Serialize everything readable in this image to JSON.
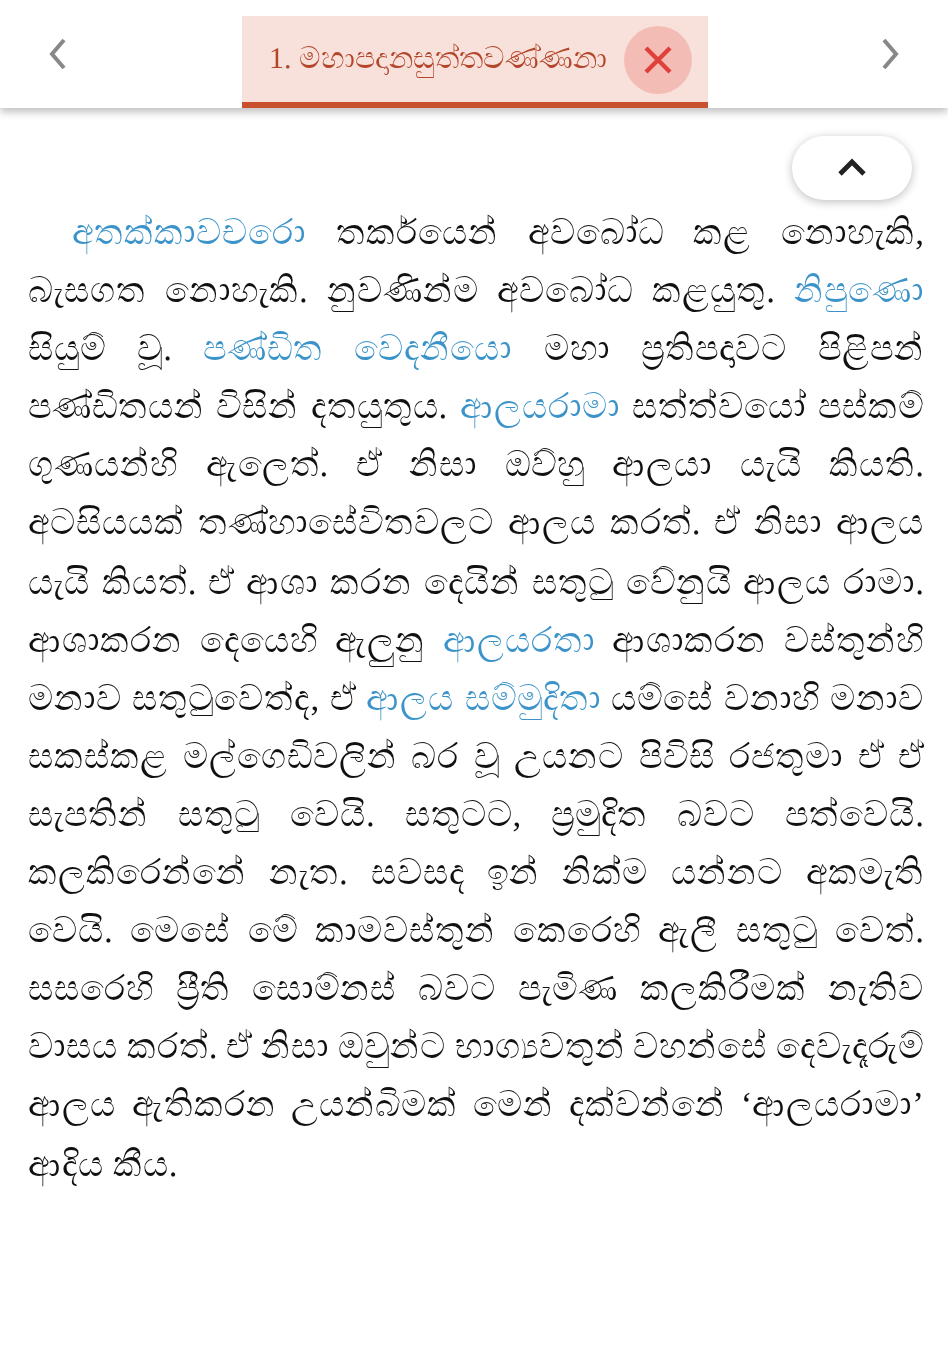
{
  "tabs": [
    {
      "title": "1. මහාපදානසුත්තවණ්ණනා",
      "selected": true
    }
  ],
  "paragraph": [
    {
      "kind": "term",
      "text": "අතක්කාවචරො"
    },
    {
      "kind": "plain",
      "text": " තර්කයෙන් අවබෝධ කළ නොහැකි, බැසගත නොහැකි. නුවණින්ම අවබෝධ කළයුතු. "
    },
    {
      "kind": "term",
      "text": "නිපුණො"
    },
    {
      "kind": "plain",
      "text": " සියුම් වූ. "
    },
    {
      "kind": "term",
      "text": "පණ්ඩිත වෙදනීයො"
    },
    {
      "kind": "plain",
      "text": " මහා ප්‍රතිපදාවට පිළිපන් පණ්ඩිතයන් විසින් දතයුතුය. "
    },
    {
      "kind": "term",
      "text": "ආලයරාමා"
    },
    {
      "kind": "plain",
      "text": " සත්ත්වයෝ පස්කම් ගුණයන්හි ඇලෙත්. ඒ නිසා ඔව්හු ආලයා යැයි කියති. අටසියයක් තණ්හාසේවිතවලට ආලය කරත්. ඒ නිසා ආලය යැයි කියත්. ඒ ආශා කරන දෙයින් සතුටු වේනුයි ආලය රාමා. ආශාකරන දෙයෙහි ඇලුනු "
    },
    {
      "kind": "term",
      "text": "ආලයරතා"
    },
    {
      "kind": "plain",
      "text": " ආශාකරන වස්තුන්හි මනාව සතුටුවෙත්ද, ඒ "
    },
    {
      "kind": "term",
      "text": "ආලය සම්මුදිතා"
    },
    {
      "kind": "plain",
      "text": " යම්සේ වනාහි මනාව සකස්කළ මල්ගෙඩිවලින් බර වූ උයනට පිවිසි රජතුමා ඒ ඒ සැපතින් සතුටු වෙයි. සතුටට, ප්‍රමුදිත බවට පත්වෙයි. කලකිරෙන්නේ නැත. සවසද ඉන් නික්ම යන්නට අකමැති වෙයි. මෙසේ මේ කාමවස්තුන් කෙරෙහි ඇලී සතුටු වෙත්. සසරෙහි ප්‍රීති සොම්නස් බවට පැමිණ කලකිරීමක් නැතිව වාසය කරත්. ඒ නිසා ඔවුන්ට භාග්‍යවතුන් වහන්සේ දෙවැදෑරුම් ආලය ඇතිකරන උයන්බිමක් මෙන් දක්වන්නේ ‘ආලයරාමා’ ආදිය කීය."
    }
  ]
}
